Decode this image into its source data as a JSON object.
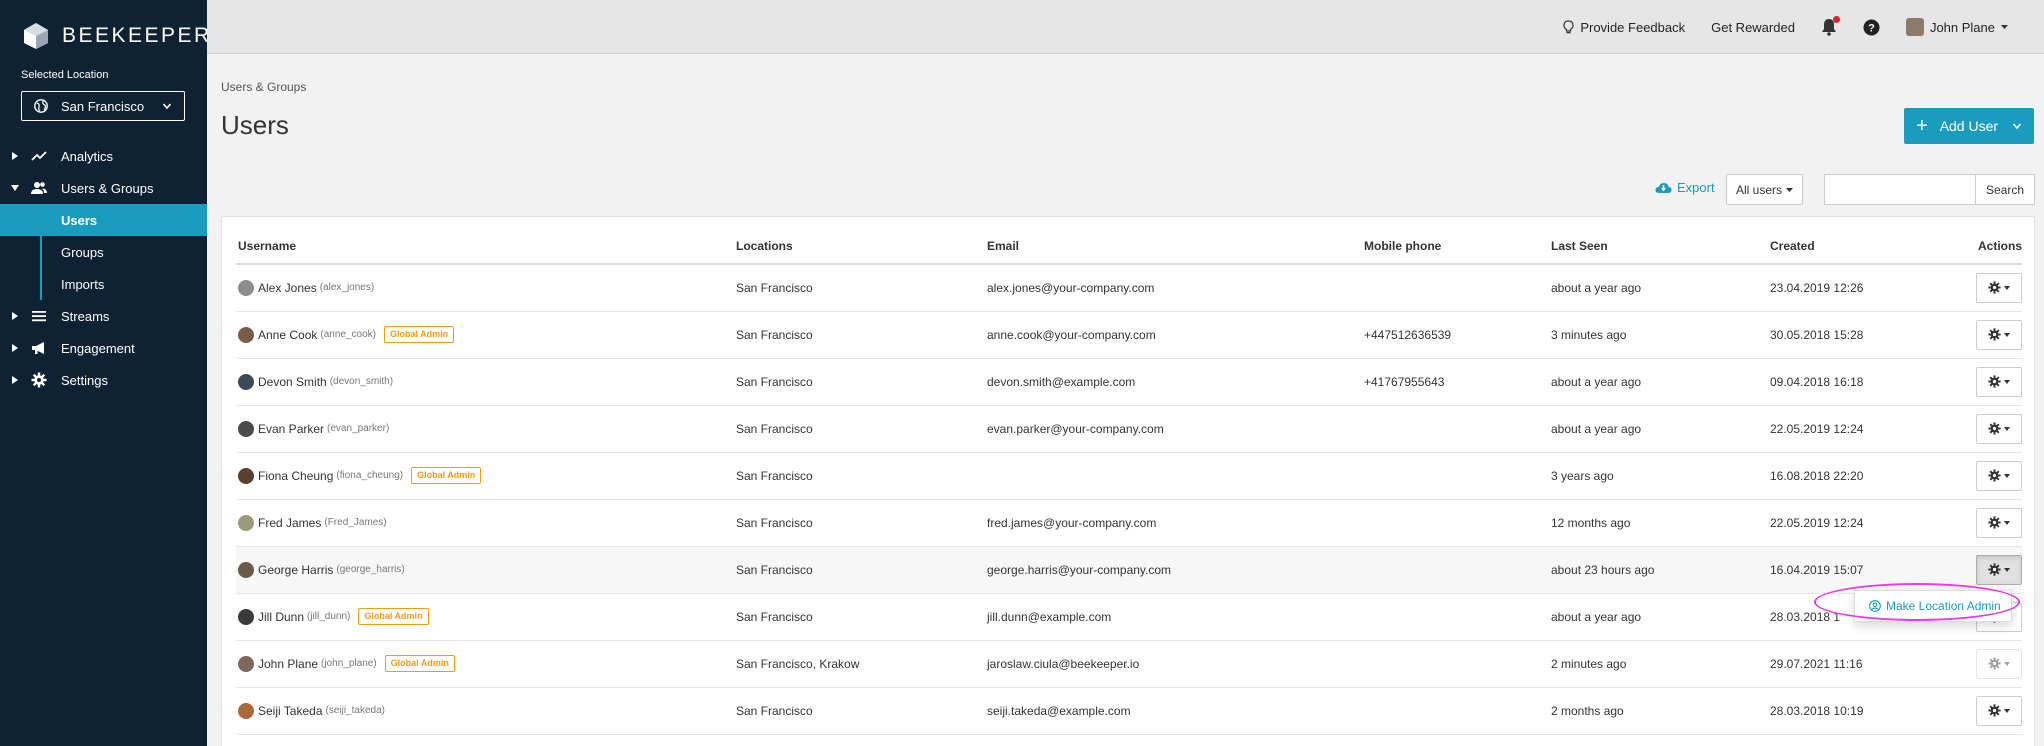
{
  "app": {
    "brand_name": "BEEKEEPER"
  },
  "sidebar": {
    "location_label": "Selected Location",
    "location_value": "San Francisco",
    "nav": [
      {
        "label": "Analytics",
        "icon": "trend-line-icon"
      },
      {
        "label": "Users & Groups",
        "icon": "users-icon",
        "expanded": true,
        "children": [
          {
            "label": "Users",
            "active": true
          },
          {
            "label": "Groups"
          },
          {
            "label": "Imports"
          }
        ]
      },
      {
        "label": "Streams",
        "icon": "list-icon"
      },
      {
        "label": "Engagement",
        "icon": "megaphone-icon"
      },
      {
        "label": "Settings",
        "icon": "gear-icon"
      }
    ]
  },
  "topbar": {
    "feedback": "Provide Feedback",
    "rewarded": "Get Rewarded",
    "user_name": "John Plane"
  },
  "page": {
    "breadcrumb": "Users & Groups",
    "title": "Users",
    "add_user_label": "Add User",
    "export_label": "Export",
    "filter_label": "All users",
    "search_placeholder": "",
    "search_button": "Search"
  },
  "table": {
    "headers": [
      "Username",
      "Locations",
      "Email",
      "Mobile phone",
      "Last Seen",
      "Created",
      "Actions"
    ],
    "rows": [
      {
        "name": "Alex Jones",
        "handle": "(alex_jones)",
        "badge": "",
        "locations": "San Francisco",
        "email": "alex.jones@your-company.com",
        "phone": "",
        "last_seen": "about a year ago",
        "created": "23.04.2019 12:26"
      },
      {
        "name": "Anne Cook",
        "handle": "(anne_cook)",
        "badge": "Global Admin",
        "locations": "San Francisco",
        "email": "anne.cook@your-company.com",
        "phone": "+447512636539",
        "last_seen": "3 minutes ago",
        "created": "30.05.2018 15:28"
      },
      {
        "name": "Devon Smith",
        "handle": "(devon_smith)",
        "badge": "",
        "locations": "San Francisco",
        "email": "devon.smith@example.com",
        "phone": "+41767955643",
        "last_seen": "about a year ago",
        "created": "09.04.2018 16:18"
      },
      {
        "name": "Evan Parker",
        "handle": "(evan_parker)",
        "badge": "",
        "locations": "San Francisco",
        "email": "evan.parker@your-company.com",
        "phone": "",
        "last_seen": "about a year ago",
        "created": "22.05.2019 12:24"
      },
      {
        "name": "Fiona Cheung",
        "handle": "(fiona_cheung)",
        "badge": "Global Admin",
        "locations": "San Francisco",
        "email": "",
        "phone": "",
        "last_seen": "3 years ago",
        "created": "16.08.2018 22:20"
      },
      {
        "name": "Fred James",
        "handle": "(Fred_James)",
        "badge": "",
        "locations": "San Francisco",
        "email": "fred.james@your-company.com",
        "phone": "",
        "last_seen": "12 months ago",
        "created": "22.05.2019 12:24"
      },
      {
        "name": "George Harris",
        "handle": "(george_harris)",
        "badge": "",
        "locations": "San Francisco",
        "email": "george.harris@your-company.com",
        "phone": "",
        "last_seen": "about 23 hours ago",
        "created": "16.04.2019 15:07"
      },
      {
        "name": "Jill Dunn",
        "handle": "(jill_dunn)",
        "badge": "Global Admin",
        "locations": "San Francisco",
        "email": "jill.dunn@example.com",
        "phone": "",
        "last_seen": "about a year ago",
        "created": "28.03.2018 1"
      },
      {
        "name": "John Plane",
        "handle": "(john_plane)",
        "badge": "Global Admin",
        "locations": "San Francisco, Krakow",
        "email": "jaroslaw.ciula@beekeeper.io",
        "phone": "",
        "last_seen": "2 minutes ago",
        "created": "29.07.2021 11:16"
      },
      {
        "name": "Seiji Takeda",
        "handle": "(seiji_takeda)",
        "badge": "",
        "locations": "San Francisco",
        "email": "seiji.takeda@example.com",
        "phone": "",
        "last_seen": "2 months ago",
        "created": "28.03.2018 10:19"
      }
    ]
  },
  "dropdown": {
    "item_label": "Make Location Admin"
  },
  "colors": {
    "sidebar_bg": "#0f2233",
    "accent": "#1a9cc0",
    "badge": "#f39c12",
    "highlight": "#e63ce6"
  }
}
